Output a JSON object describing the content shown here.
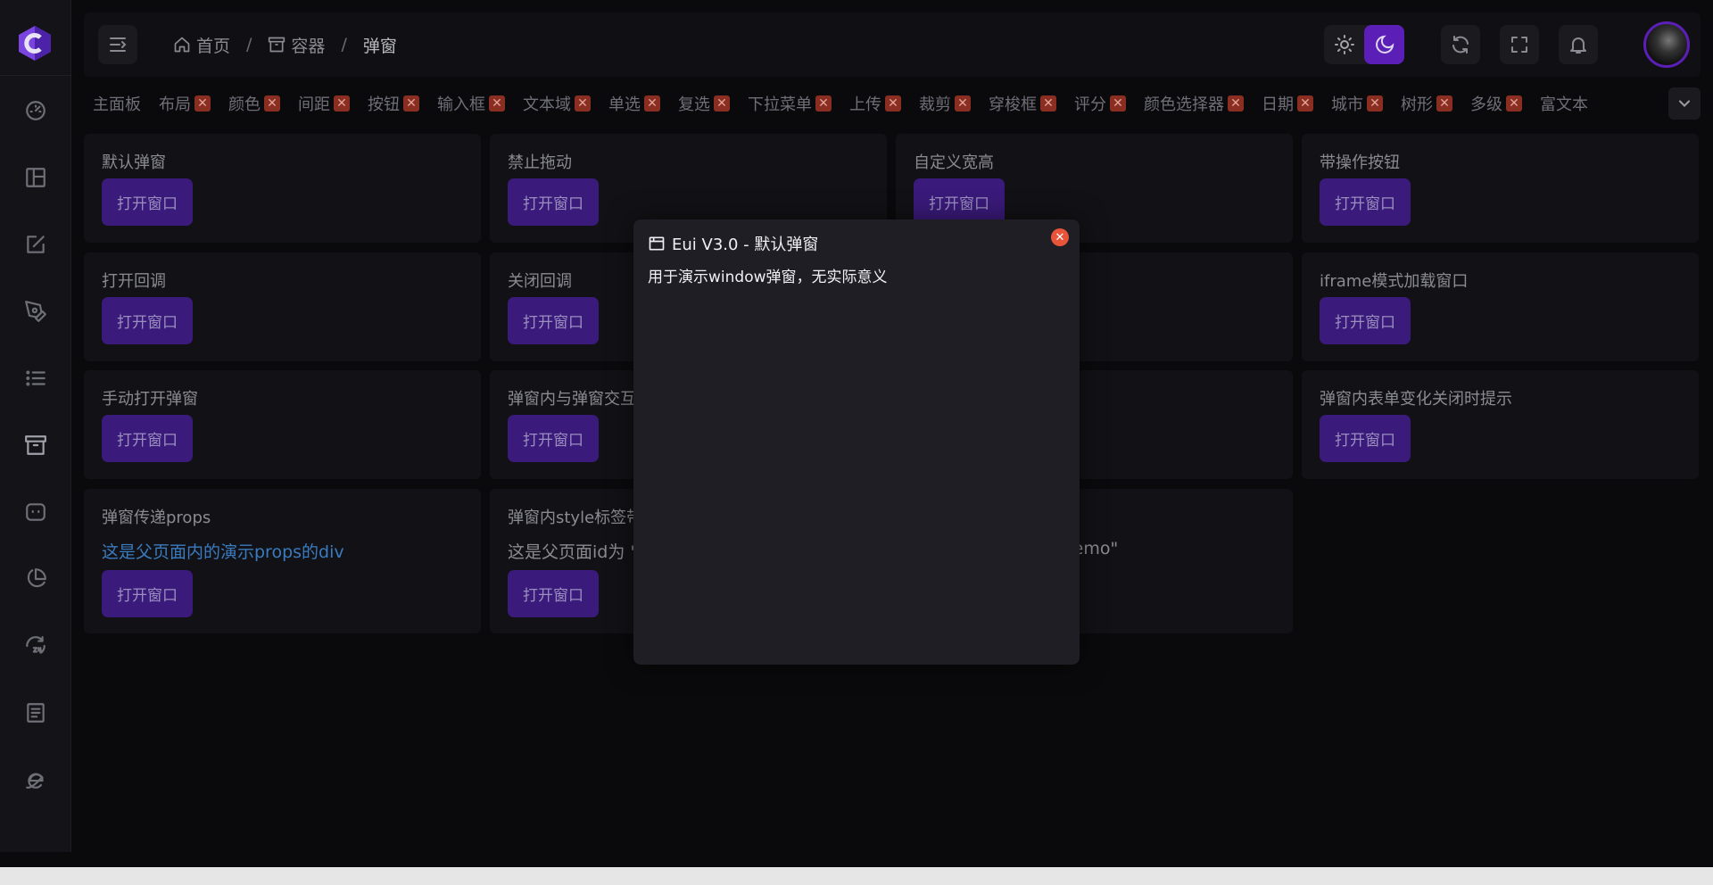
{
  "breadcrumb": [
    "首页",
    "容器",
    "弹窗"
  ],
  "tabs": [
    "主面板",
    "布局",
    "颜色",
    "间距",
    "按钮",
    "输入框",
    "文本域",
    "单选",
    "复选",
    "下拉菜单",
    "上传",
    "裁剪",
    "穿梭框",
    "评分",
    "颜色选择器",
    "日期",
    "城市",
    "树形",
    "多级",
    "富文本"
  ],
  "tab_close_glyph": "✕",
  "open_label": "打开窗口",
  "cards": [
    {
      "title": "默认弹窗"
    },
    {
      "title": "禁止拖动"
    },
    {
      "title": "自定义宽高"
    },
    {
      "title": "带操作按钮"
    },
    {
      "title": "打开回调"
    },
    {
      "title": "关闭回调"
    },
    {
      "title": "iframe模式加载窗口"
    },
    {
      "title": "手动打开弹窗"
    },
    {
      "title": "弹窗内与弹窗交互"
    },
    {
      "title": "弹窗内表单变化关闭时提示"
    },
    {
      "title": "弹窗传递props",
      "text": "这是父页面内的演示props的div"
    },
    {
      "title": "弹窗内style标签带",
      "text": "这是父页面id为 \"c"
    },
    {
      "text": "hDemo\""
    }
  ],
  "modal": {
    "title": "Eui V3.0 - 默认弹窗",
    "body": "用于演示window弹窗，无实际意义",
    "close_glyph": "✕"
  },
  "colors": {
    "accent": "#5b1fb8",
    "button_bg": "#3a1a7a",
    "link_text": "#3a7bbf",
    "close_red": "#e8543a"
  }
}
